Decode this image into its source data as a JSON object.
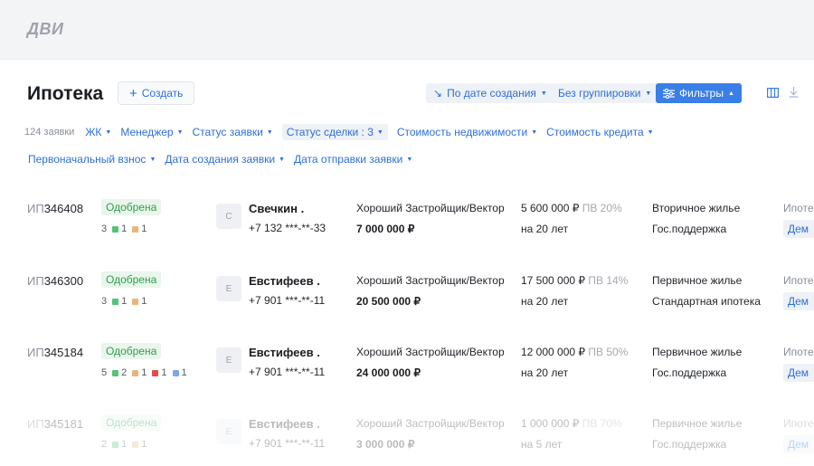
{
  "header": {
    "logo_text": "ДВИ"
  },
  "page": {
    "title": "Ипотека",
    "create_label": "Создать"
  },
  "toolbar": {
    "sort_label": "По дате создания",
    "group_label": "Без группировки",
    "filters_label": "Фильтры",
    "accent_color": "#3a7ee8"
  },
  "filters": {
    "count_label": "124 заявки",
    "chips": [
      {
        "label": "ЖК"
      },
      {
        "label": "Менеджер"
      },
      {
        "label": "Статус заявки"
      },
      {
        "label": "Статус сделки : 3"
      },
      {
        "label": "Стоимость недвижимости"
      },
      {
        "label": "Стоимость кредита"
      },
      {
        "label": "Первоначальный взнос"
      },
      {
        "label": "Дата создания заявки"
      },
      {
        "label": "Дата отправки заявки"
      }
    ]
  },
  "applications": [
    {
      "id_prefix": "ИП",
      "id_number": "346408",
      "status": "Одобрена",
      "docs_total": "3",
      "docs_green": "1",
      "docs_orange": "1",
      "avatar_letter": "С",
      "client_name": "Свечкин .",
      "client_phone": "+7 132 ***-**-33",
      "developer": "Хороший Застройщик/Вектор",
      "property_price": "7 000 000 ₽",
      "loan_amount": "5 600 000 ₽",
      "down_payment": "ПВ 20%",
      "term": "на 20 лет",
      "housing_type": "Вторичное жилье",
      "program": "Гос.поддержка",
      "bank_label": "Ипотека",
      "bank_badge": "Дем"
    },
    {
      "id_prefix": "ИП",
      "id_number": "346300",
      "status": "Одобрена",
      "docs_total": "3",
      "docs_green": "1",
      "docs_orange": "1",
      "avatar_letter": "Е",
      "client_name": "Евстифеев .",
      "client_phone": "+7 901 ***-**-11",
      "developer": "Хороший Застройщик/Вектор",
      "property_price": "20 500 000 ₽",
      "loan_amount": "17 500 000 ₽",
      "down_payment": "ПВ 14%",
      "term": "на 20 лет",
      "housing_type": "Первичное жилье",
      "program": "Стандартная ипотека",
      "bank_label": "Ипотека",
      "bank_badge": "Дем"
    },
    {
      "id_prefix": "ИП",
      "id_number": "345184",
      "status": "Одобрена",
      "docs_total": "5",
      "docs_green": "2",
      "docs_orange": "1",
      "docs_red": "1",
      "docs_blue": "1",
      "avatar_letter": "Е",
      "client_name": "Евстифеев .",
      "client_phone": "+7 901 ***-**-11",
      "developer": "Хороший Застройщик/Вектор",
      "property_price": "24 000 000 ₽",
      "loan_amount": "12 000 000 ₽",
      "down_payment": "ПВ 50%",
      "term": "на 20 лет",
      "housing_type": "Первичное жилье",
      "program": "Гос.поддержка",
      "bank_label": "Ипотека",
      "bank_badge": "Дем"
    },
    {
      "id_prefix": "ИП",
      "id_number": "345181",
      "status": "Одобрена",
      "docs_total": "2",
      "docs_green": "1",
      "docs_orange": "1",
      "avatar_letter": "Е",
      "client_name": "Евстифеев .",
      "client_phone": "+7 901 ***-**-11",
      "developer": "Хороший Застройщик/Вектор",
      "property_price": "3 000 000 ₽",
      "loan_amount": "1 000 000 ₽",
      "down_payment": "ПВ 70%",
      "term": "на 5 лет",
      "housing_type": "Первичное жилье",
      "program": "Гос.поддержка",
      "bank_label": "Ипотека",
      "bank_badge": "Дем"
    }
  ],
  "colors": {
    "green": "#53c47a",
    "orange": "#e9b67a",
    "red": "#e3484f",
    "blue": "#7fa6e6"
  }
}
